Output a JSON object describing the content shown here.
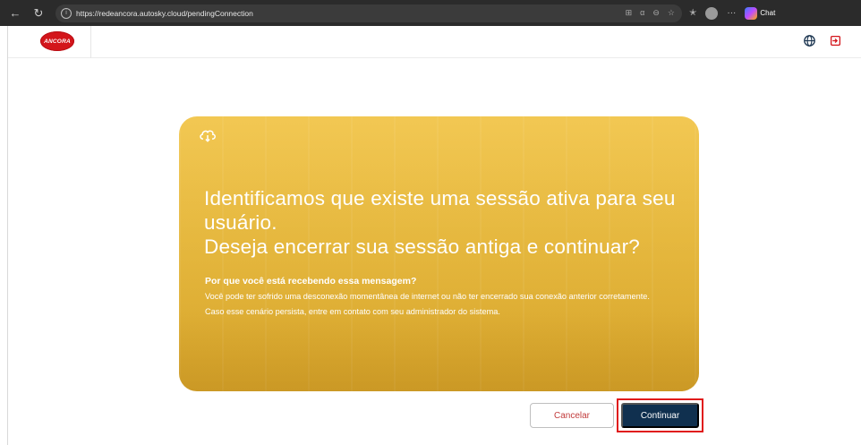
{
  "browser": {
    "url": "https://redeancora.autosky.cloud/pendingConnection",
    "copilot_label": "Chat",
    "more_label": "···"
  },
  "app": {
    "brand_text": "ANCORA"
  },
  "dialog": {
    "headline_1": "Identificamos que existe uma sessão ativa para seu usuário.",
    "headline_2": "Deseja encerrar sua sessão antiga e continuar?",
    "subtitle": "Por que você está recebendo essa mensagem?",
    "body_1": "Você pode ter sofrido uma desconexão momentânea de internet ou não ter encerrado sua conexão anterior corretamente.",
    "body_2": "Caso esse cenário persista, entre em contato com seu administrador do sistema."
  },
  "actions": {
    "cancel_label": "Cancelar",
    "continue_label": "Continuar"
  },
  "colors": {
    "card": "#eab937",
    "primary_button": "#10304f",
    "cancel_text": "#c23b3b",
    "highlight": "#e01b1b",
    "brand": "#d3151b"
  }
}
